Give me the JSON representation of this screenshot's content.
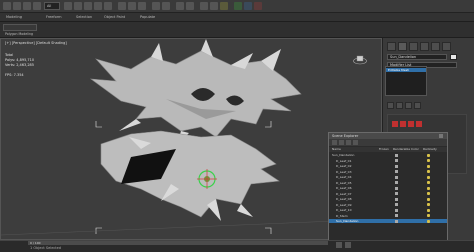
{
  "toolbar": {
    "label": "All"
  },
  "ribbon": {
    "tabs": [
      "Modeling",
      "Freeform",
      "Selection",
      "Object Paint",
      "Populate"
    ],
    "section": "Polygon Modeling"
  },
  "viewport": {
    "label": "[+] [Perspective] [Default Shading]",
    "stats": "Total\nPolys: 4,895,710\nVerts: 2,463,285\n\nFPS: 7.354"
  },
  "command_panel": {
    "object_name": "Sun_Dandelion",
    "modifier_list": "Modifier List",
    "selected_modifier": "Editable Mesh"
  },
  "scene_explorer": {
    "title": "Scene Explorer",
    "columns": [
      "Name",
      "Frozen",
      "Renderable",
      "Color",
      "Radiosity"
    ],
    "rows": [
      {
        "name": "Sun_Dandelion",
        "selected": false
      },
      {
        "name": "D_Leaf_01",
        "selected": false
      },
      {
        "name": "D_Leaf_02",
        "selected": false
      },
      {
        "name": "D_Leaf_03",
        "selected": false
      },
      {
        "name": "D_Leaf_04",
        "selected": false
      },
      {
        "name": "D_Leaf_05",
        "selected": false
      },
      {
        "name": "D_Leaf_06",
        "selected": false
      },
      {
        "name": "D_Leaf_07",
        "selected": false
      },
      {
        "name": "D_Leaf_08",
        "selected": false
      },
      {
        "name": "D_Leaf_09",
        "selected": false
      },
      {
        "name": "D_Leaf_10",
        "selected": false
      },
      {
        "name": "D_Stem",
        "selected": false
      },
      {
        "name": "Sun_Dandelion",
        "selected": true
      }
    ]
  },
  "status": {
    "frame": "0 / 100",
    "text": "1 Object Selected"
  },
  "colors": {
    "accent": "#2f6fa8",
    "viewport_bg": "#3d3d3d"
  }
}
